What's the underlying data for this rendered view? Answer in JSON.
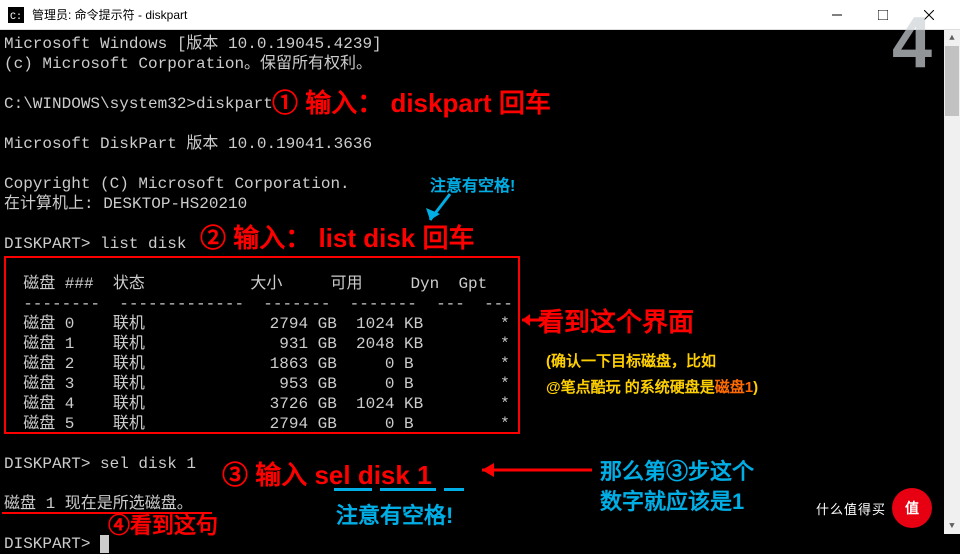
{
  "window": {
    "title": "管理员: 命令提示符 - diskpart",
    "step_watermark": "4"
  },
  "term": {
    "l1": "Microsoft Windows [版本 10.0.19045.4239]",
    "l2": "(c) Microsoft Corporation。保留所有权利。",
    "l3": "C:\\WINDOWS\\system32>diskpart",
    "l4": "Microsoft DiskPart 版本 10.0.19041.3636",
    "l5": "Copyright (C) Microsoft Corporation.",
    "l6": "在计算机上: DESKTOP-HS20210",
    "l7": "DISKPART> list disk",
    "th": "  磁盘 ###  状态           大小     可用     Dyn  Gpt",
    "tdiv": "  --------  -------------  -------  -------  ---  ---",
    "r0": "  磁盘 0    联机             2794 GB  1024 KB        *",
    "r1": "  磁盘 1    联机              931 GB  2048 KB        *",
    "r2": "  磁盘 2    联机             1863 GB     0 B         *",
    "r3": "  磁盘 3    联机              953 GB     0 B         *",
    "r4": "  磁盘 4    联机             3726 GB  1024 KB        *",
    "r5": "  磁盘 5    联机             2794 GB     0 B         *",
    "l8": "DISKPART> sel disk 1",
    "l9": "磁盘 1 现在是所选磁盘。",
    "l10": "DISKPART> "
  },
  "annot": {
    "a1": "① 输入： diskpart 回车",
    "note_space_top": "注意有空格!",
    "a2": "② 输入：  list disk 回车",
    "saw_title": "看到这个界面",
    "confirm_line": "(确认一下目标磁盘，比如",
    "confirm_line2a": "@笔点酷玩 的系统硬盘是",
    "confirm_line2b": "磁盘1",
    "confirm_line2c": ")",
    "a3": "③ 输入  sel disk 1",
    "note_space_bottom": "注意有空格!",
    "step3_hint_a": "那么第③步这个",
    "step3_hint_b": "数字就应该是1",
    "a4": "④看到这句"
  },
  "badge": {
    "logo_text": "什么值得买",
    "logo_char": "值"
  }
}
